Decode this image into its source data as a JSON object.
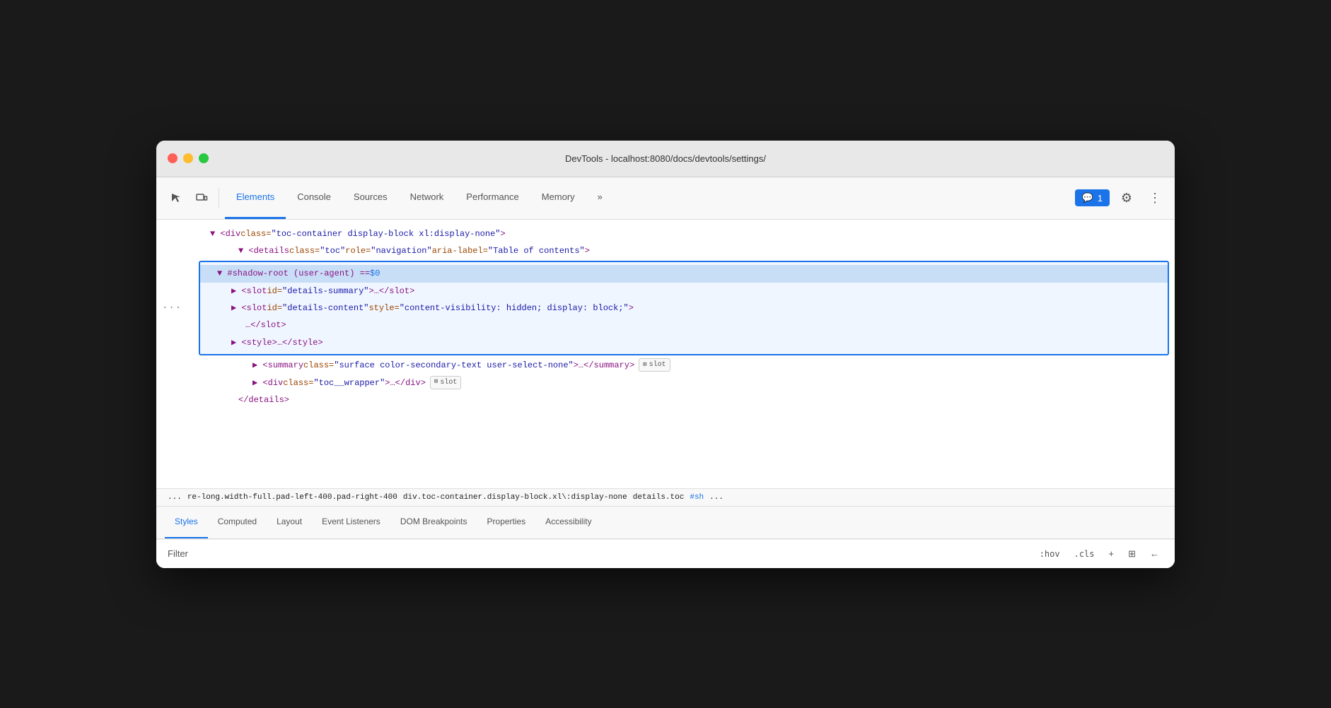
{
  "window": {
    "title": "DevTools - localhost:8080/docs/devtools/settings/"
  },
  "toolbar": {
    "tabs": [
      {
        "id": "elements",
        "label": "Elements",
        "active": true
      },
      {
        "id": "console",
        "label": "Console",
        "active": false
      },
      {
        "id": "sources",
        "label": "Sources",
        "active": false
      },
      {
        "id": "network",
        "label": "Network",
        "active": false
      },
      {
        "id": "performance",
        "label": "Performance",
        "active": false
      },
      {
        "id": "memory",
        "label": "Memory",
        "active": false
      }
    ],
    "more_label": "»",
    "chat_count": "1",
    "gear_icon": "⚙",
    "more_icon": "⋮"
  },
  "elements_panel": {
    "lines": [
      {
        "indent": 0,
        "content": "▼ <div class=\"toc-container display-block xl:display-none\">"
      },
      {
        "indent": 1,
        "content": "▼ <details class=\"toc\" role=\"navigation\" aria-label=\"Table of contents\">"
      }
    ],
    "shadow_root": {
      "header": "▼ #shadow-root (user-agent) == $0",
      "lines": [
        "▶ <slot id=\"details-summary\">…</slot>",
        "▶ <slot id=\"details-content\" style=\"content-visibility: hidden; display: block;\">",
        "    …</slot>",
        "▶ <style>…</style>"
      ]
    },
    "after_lines": [
      "▶ <summary class=\"surface color-secondary-text user-select-none\">…</summary>",
      "▶ <div class=\"toc__wrapper\">…</div>",
      "  </details>"
    ]
  },
  "breadcrumb": {
    "items": [
      "...",
      "re-long.width-full.pad-left-400.pad-right-400",
      "div.toc-container.display-block.xl\\:display-none",
      "details.toc",
      "#sh",
      "..."
    ]
  },
  "lower_tabs": {
    "tabs": [
      {
        "id": "styles",
        "label": "Styles",
        "active": true
      },
      {
        "id": "computed",
        "label": "Computed",
        "active": false
      },
      {
        "id": "layout",
        "label": "Layout",
        "active": false
      },
      {
        "id": "event-listeners",
        "label": "Event Listeners",
        "active": false
      },
      {
        "id": "dom-breakpoints",
        "label": "DOM Breakpoints",
        "active": false
      },
      {
        "id": "properties",
        "label": "Properties",
        "active": false
      },
      {
        "id": "accessibility",
        "label": "Accessibility",
        "active": false
      }
    ]
  },
  "filter": {
    "label": "Filter",
    "placeholder": "",
    "hov_label": ":hov",
    "cls_label": ".cls",
    "plus_label": "+",
    "layout_icon": "⊞",
    "arrow_icon": "←"
  }
}
